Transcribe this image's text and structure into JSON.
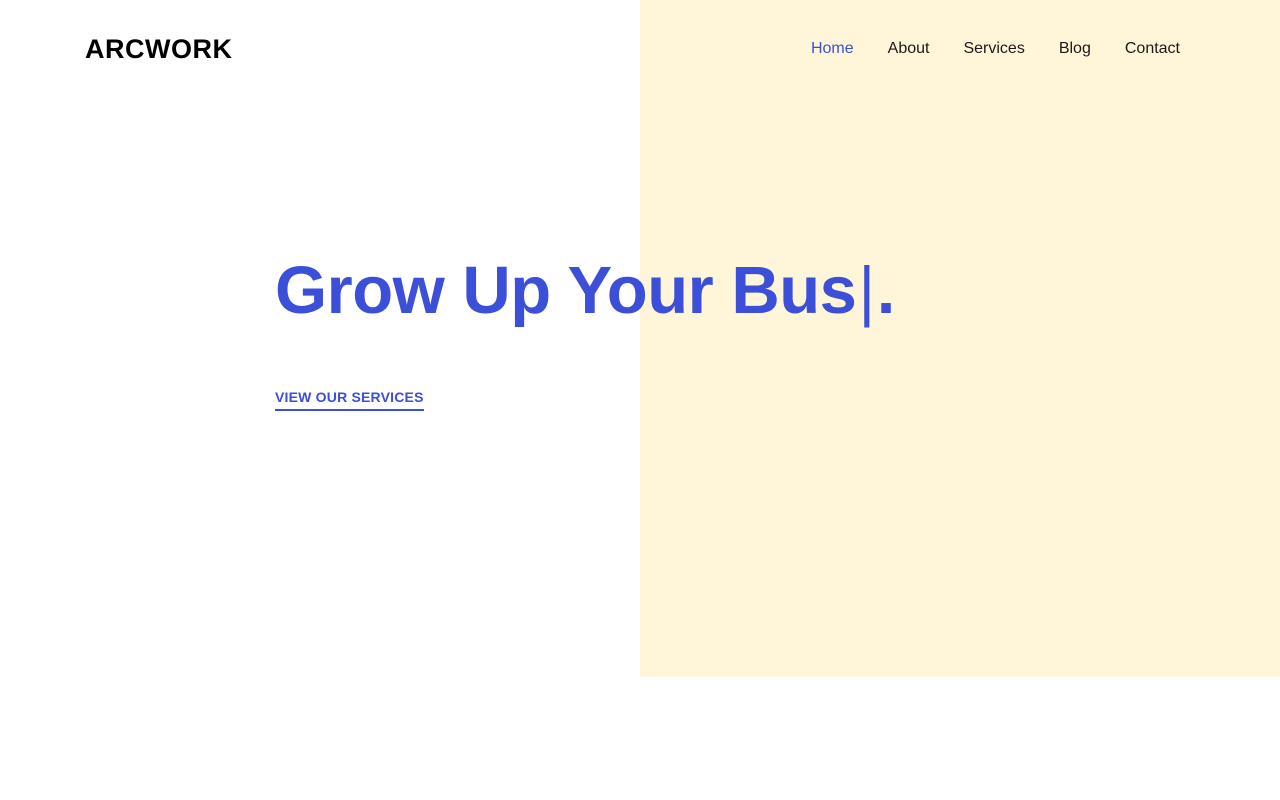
{
  "brand": {
    "name": "ARCWORK"
  },
  "nav": {
    "items": [
      {
        "label": "Home",
        "active": true
      },
      {
        "label": "About",
        "active": false
      },
      {
        "label": "Services",
        "active": false
      },
      {
        "label": "Blog",
        "active": false
      },
      {
        "label": "Contact",
        "active": false
      }
    ]
  },
  "hero": {
    "title": "Grow Up Your Bus",
    "cursor": "|",
    "period": ".",
    "cta_label": "VIEW OUR SERVICES"
  },
  "colors": {
    "accent": "#3b4fd8",
    "hero_panel": "#fff5d8",
    "text": "#000000",
    "background": "#ffffff"
  }
}
